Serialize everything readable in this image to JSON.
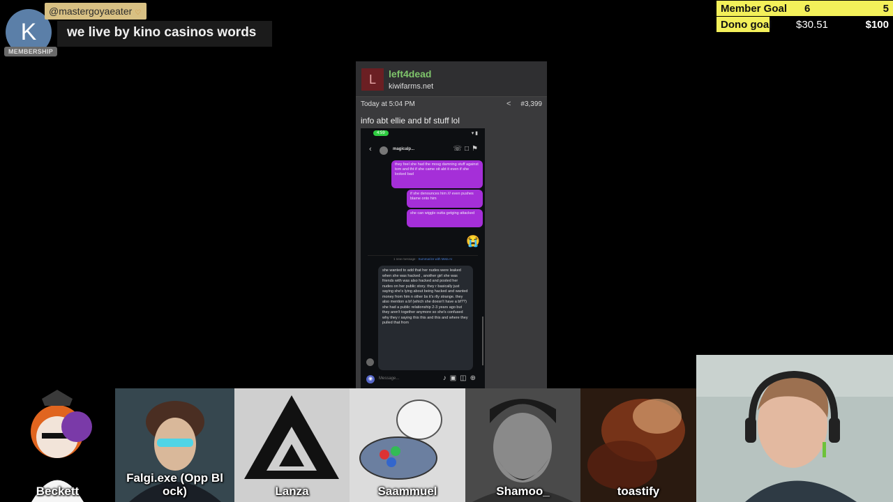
{
  "chat": {
    "avatar_letter": "K",
    "badge": "MEMBERSHIP",
    "username": "@mastergoyaeater",
    "message": "we live by kino casinos words"
  },
  "goals": {
    "member": {
      "label": "Member Goal",
      "current": "6",
      "target": "5"
    },
    "dono": {
      "label": "Dono goal",
      "current": "$30.51",
      "target": "$100"
    }
  },
  "post": {
    "avatar_letter": "L",
    "author": "left4dead",
    "site": "kiwifarms.net",
    "timestamp": "Today at 5:04 PM",
    "post_number": "#3,399",
    "body": "info abt ellie and bf stuff lol",
    "phone": {
      "time": "4:59",
      "contact": "magicalp...",
      "outgoing": [
        "they feel she had the mosg damning stuff against tom and tht if she came oit abt it even if she looked bad",
        "if she denounces him /// even pushes blame onto him",
        "she can wiggle outta getging attacked"
      ],
      "emoji": "😭",
      "divider_text": "1 new message · ",
      "divider_link": "Summarize with Meta AI",
      "incoming": "she wanted to add that her nudes were leaked when she was hacked , another girl she was friends with was also hacked and posted her nudes on her public story. they r basically just saying she's lying about being hacked and wanted money from him n other bs it's rlly strange. they also mention a bf (which she doesn't have a bf??) she had a public relationship 2-3 years ago but they aren't together anymore so she's confused why they r saying this this and this and where they pulled that from",
      "input_placeholder": "Message..."
    }
  },
  "tiles": [
    {
      "name": "Beckett"
    },
    {
      "name": "Falgi.exe (Opp Bl ock)"
    },
    {
      "name": "Lanza"
    },
    {
      "name": "Saammuel"
    },
    {
      "name": "Shamoo_"
    },
    {
      "name": "toastify"
    }
  ]
}
